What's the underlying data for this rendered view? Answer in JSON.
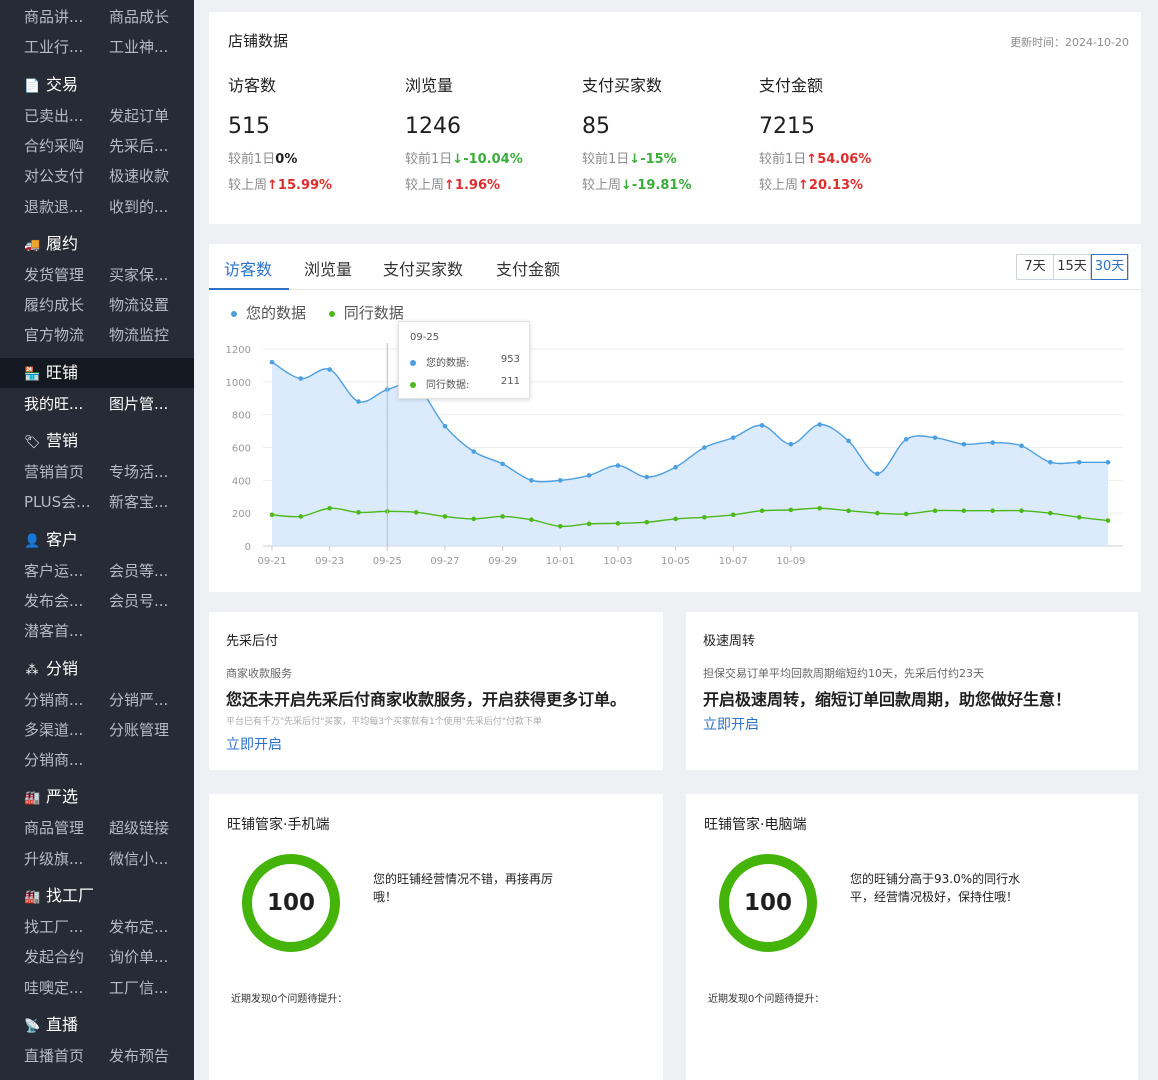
{
  "sidebar": {
    "rows1": [
      [
        "商品讲...",
        "商品成长"
      ],
      [
        "工业行...",
        "工业神..."
      ]
    ],
    "sections": [
      {
        "icon": "📄",
        "icon_name": "document-icon",
        "title": "交易",
        "rows": [
          [
            "已卖出...",
            "发起订单"
          ],
          [
            "合约采购",
            "先采后..."
          ],
          [
            "对公支付",
            "极速收款"
          ],
          [
            "退款退...",
            "收到的..."
          ]
        ]
      },
      {
        "icon": "🚚",
        "icon_name": "truck-icon",
        "title": "履约",
        "rows": [
          [
            "发货管理",
            "买家保..."
          ],
          [
            "履约成长",
            "物流设置"
          ],
          [
            "官方物流",
            "物流监控"
          ]
        ]
      },
      {
        "icon": "🏪",
        "icon_name": "shop-icon",
        "title": "旺铺",
        "rows": [
          [
            "我的旺...",
            "图片管..."
          ]
        ]
      },
      {
        "icon": "🏷",
        "icon_name": "tag-icon",
        "title": "营销",
        "rows": [
          [
            "营销首页",
            "专场活..."
          ],
          [
            "PLUS会...",
            "新客宝..."
          ]
        ]
      },
      {
        "icon": "👤",
        "icon_name": "user-icon",
        "title": "客户",
        "rows": [
          [
            "客户运...",
            "会员等..."
          ],
          [
            "发布会...",
            "会员号..."
          ],
          [
            "潜客首...",
            ""
          ]
        ]
      },
      {
        "icon": "⁂",
        "icon_name": "distribution-icon",
        "title": "分销",
        "rows": [
          [
            "分销商...",
            "分销严..."
          ],
          [
            "多渠道...",
            "分账管理"
          ],
          [
            "分销商...",
            ""
          ]
        ]
      },
      {
        "icon": "🏭",
        "icon_name": "factory-icon",
        "title": "严选",
        "rows": [
          [
            "商品管理",
            "超级链接"
          ],
          [
            "升级旗...",
            "微信小..."
          ]
        ]
      },
      {
        "icon": "🏭",
        "icon_name": "factory-search-icon",
        "title": "找工厂",
        "rows": [
          [
            "找工厂...",
            "发布定..."
          ],
          [
            "发起合约",
            "询价单..."
          ],
          [
            "哇噢定...",
            "工厂信..."
          ]
        ]
      },
      {
        "icon": "📡",
        "icon_name": "live-icon",
        "title": "直播",
        "rows": [
          [
            "直播首页",
            "发布预告"
          ]
        ]
      }
    ]
  },
  "store": {
    "title": "店铺数据",
    "updated": "更新时间：2024-10-20",
    "metrics": [
      {
        "label": "访客数",
        "value": "515",
        "day_prefix": "较前1日",
        "day_arrow": "",
        "day_val": "0%",
        "day_dir": "zero",
        "week_prefix": "较上周",
        "week_arrow": "↑",
        "week_val": "15.99%",
        "week_dir": "up"
      },
      {
        "label": "浏览量",
        "value": "1246",
        "day_prefix": "较前1日",
        "day_arrow": "↓",
        "day_val": "-10.04%",
        "day_dir": "dn",
        "week_prefix": "较上周",
        "week_arrow": "↑",
        "week_val": "1.96%",
        "week_dir": "up"
      },
      {
        "label": "支付买家数",
        "value": "85",
        "day_prefix": "较前1日",
        "day_arrow": "↓",
        "day_val": "-15%",
        "day_dir": "dn",
        "week_prefix": "较上周",
        "week_arrow": "↓",
        "week_val": "-19.81%",
        "week_dir": "dn"
      },
      {
        "label": "支付金额",
        "value": "7215",
        "day_prefix": "较前1日",
        "day_arrow": "↑",
        "day_val": "54.06%",
        "day_dir": "up",
        "week_prefix": "较上周",
        "week_arrow": "↑",
        "week_val": "20.13%",
        "week_dir": "up"
      }
    ]
  },
  "trend": {
    "tabs": [
      "访客数",
      "浏览量",
      "支付买家数",
      "支付金额"
    ],
    "active_tab": 0,
    "ranges": [
      "7天",
      "15天",
      "30天"
    ],
    "selected_range": 2,
    "tooltip": {
      "date": "09-25",
      "rows": [
        {
          "label": "您的数据:",
          "value": "953"
        },
        {
          "label": "同行数据:",
          "value": "211"
        }
      ]
    }
  },
  "chart_data": {
    "type": "line",
    "x": [
      "09-21",
      "09-22",
      "09-23",
      "09-24",
      "09-25",
      "09-26",
      "09-27",
      "09-28",
      "09-29",
      "09-30",
      "10-01",
      "10-02",
      "10-03",
      "10-04",
      "10-05",
      "10-06",
      "10-07",
      "10-08",
      "10-09",
      "10-10",
      "10-11",
      "10-12",
      "10-13",
      "10-14",
      "10-15",
      "10-16",
      "10-17",
      "10-18",
      "10-19",
      "10-20"
    ],
    "xticks": [
      "09-21",
      "09-23",
      "09-25",
      "09-27",
      "09-29",
      "10-01",
      "10-03",
      "10-05",
      "10-07",
      "10-09"
    ],
    "series": [
      {
        "name": "您的数据",
        "color": "#4c9fe0",
        "area": true,
        "values": [
          1120,
          1020,
          1075,
          880,
          953,
          975,
          730,
          575,
          500,
          400,
          400,
          430,
          490,
          420,
          480,
          600,
          660,
          735,
          620,
          740,
          640,
          440,
          650,
          660,
          620,
          630,
          610,
          510,
          510,
          510
        ]
      },
      {
        "name": "同行数据",
        "color": "#4cb81c",
        "area": false,
        "values": [
          190,
          180,
          230,
          205,
          211,
          205,
          180,
          165,
          180,
          160,
          120,
          135,
          138,
          145,
          165,
          175,
          190,
          215,
          220,
          230,
          215,
          200,
          195,
          215,
          215,
          215,
          215,
          200,
          175,
          155
        ]
      }
    ],
    "yticks": [
      0,
      200,
      400,
      600,
      800,
      1000,
      1200
    ],
    "ylim": [
      0,
      1200
    ],
    "grid": true,
    "legend": "top-left"
  },
  "promo": {
    "xc": {
      "title": "先采后付",
      "sub": "商家收款服务",
      "head": "您还未开启先采后付商家收款服务，开启获得更多订单。",
      "note": "平台已有千万\"先采后付\"买家，平均每3个买家就有1个使用\"先采后付\"付款下单",
      "link": "立即开启"
    },
    "js": {
      "title": "极速周转",
      "sub": "担保交易订单平均回款周期缩短约10天，先采后付约23天",
      "head": "开启极速周转，缩短订单回款周期，助您做好生意！",
      "link": "立即开启"
    }
  },
  "score": {
    "mobile": {
      "title": "旺铺管家·手机端",
      "value": "100",
      "msg": "您的旺铺经营情况不错，再接再厉哦！",
      "foot": "近期发现0个问题待提升："
    },
    "pc": {
      "title": "旺铺管家·电脑端",
      "value": "100",
      "msg": "您的旺铺分高于93.0%的同行水平，经营情况极好，保持住哦！",
      "foot": "近期发现0个问题待提升："
    }
  }
}
